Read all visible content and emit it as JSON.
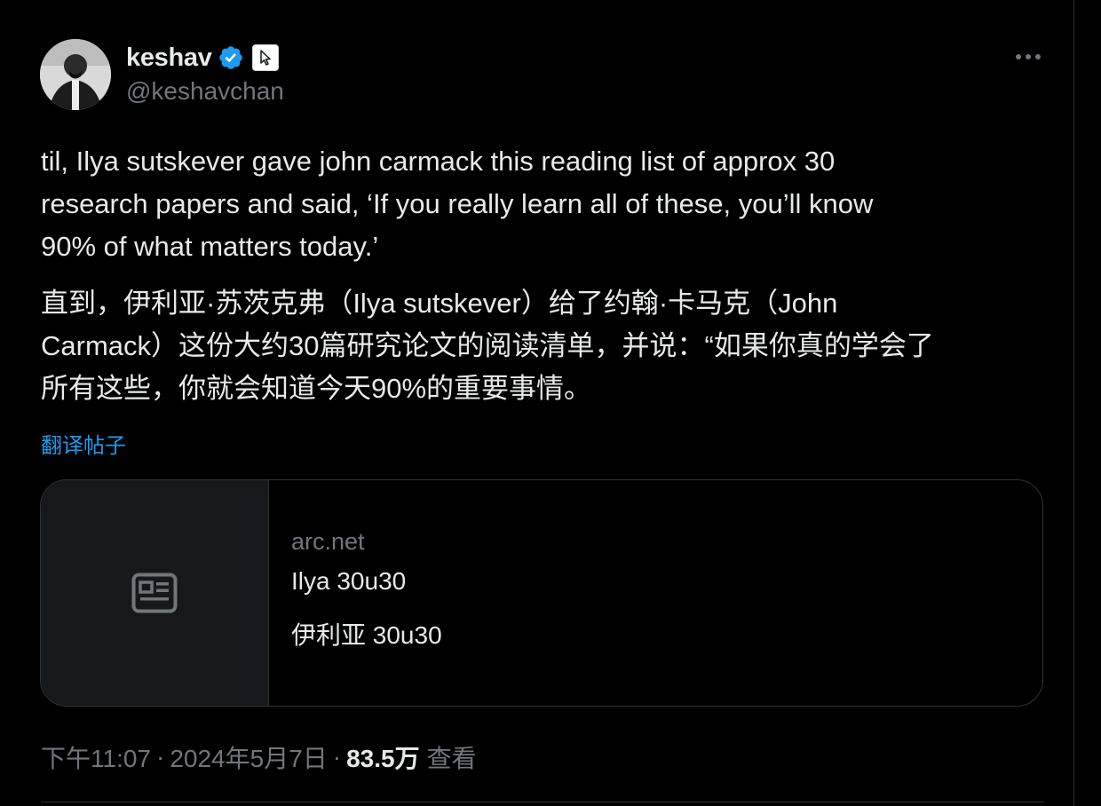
{
  "author": {
    "display_name": "keshav",
    "handle": "@keshavchan"
  },
  "post": {
    "text_en_lines": [
      "til, Ilya sutskever gave john carmack this reading list of approx 30",
      "research papers and said, ‘If you really learn all of these, you’ll know",
      "90% of what matters today.’"
    ],
    "text_zh_lines": [
      "直到，伊利亚·苏茨克弗（Ilya sutskever）给了约翰·卡马克（John",
      "Carmack）这份大约30篇研究论文的阅读清单，并说：“如果你真的学会了",
      "所有这些，你就会知道今天90%的重要事情。"
    ],
    "translate_label": "翻译帖子"
  },
  "link_card": {
    "domain": "arc.net",
    "title": "Ilya 30u30",
    "description": "伊利亚 30u30",
    "thumbnail_icon": "article-icon"
  },
  "meta": {
    "time": "下午11:07",
    "date": "2024年5月7日",
    "separator": "·",
    "views_count": "83.5万",
    "views_label": "查看"
  },
  "colors": {
    "background": "#000000",
    "text": "#e7e9ea",
    "muted": "#71767b",
    "accent": "#1d9bf0",
    "border": "#2f3336"
  }
}
